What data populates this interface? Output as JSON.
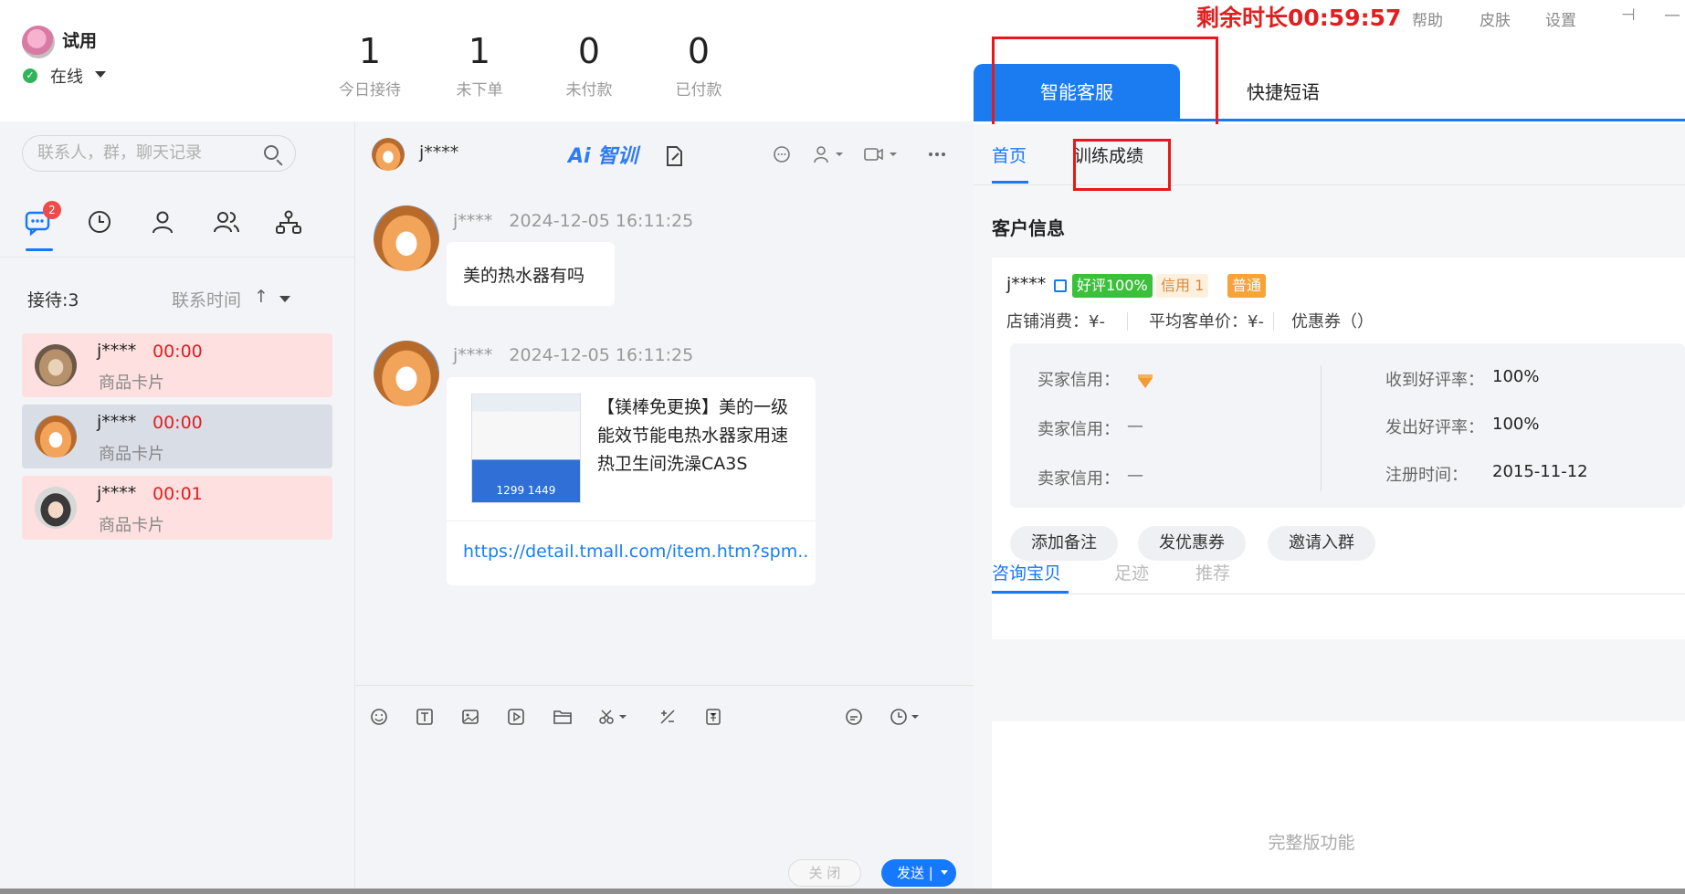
{
  "user": {
    "name": "试用",
    "status": "在线"
  },
  "stats": [
    {
      "value": "1",
      "label": "今日接待"
    },
    {
      "value": "1",
      "label": "未下单"
    },
    {
      "value": "0",
      "label": "未付款"
    },
    {
      "value": "0",
      "label": "已付款"
    }
  ],
  "topbar": {
    "timer": "剩余时长00:59:57",
    "help": "帮助",
    "skin": "皮肤",
    "settings": "设置"
  },
  "left": {
    "search_placeholder": "联系人，群，聊天记录",
    "nav_badge": "2",
    "receiving": "接待:3",
    "sort_label": "联系时间",
    "sort_arrow": "↑",
    "conversations": [
      {
        "name": "j****",
        "time": "00:00",
        "sub": "商品卡片"
      },
      {
        "name": "j****",
        "time": "00:00",
        "sub": "商品卡片"
      },
      {
        "name": "j****",
        "time": "00:01",
        "sub": "商品卡片"
      }
    ]
  },
  "chat": {
    "contact": "j****",
    "ai_logo": "Ai 智训",
    "messages": [
      {
        "sender": "j****",
        "time": "2024-12-05 16:11:25",
        "text": "美的热水器有吗"
      },
      {
        "sender": "j****",
        "time": "2024-12-05 16:11:25",
        "card_title": "【镁棒免更换】美的一级能效节能电热水器家用速热卫生间洗澡CA3S",
        "card_thumb_text": "1299   1449",
        "card_link": "https://detail.tmall.com/item.htm?spm..."
      }
    ],
    "close_label": "关 闭",
    "send_label": "发送 |"
  },
  "right": {
    "tabs": [
      "智能客服",
      "快捷短语"
    ],
    "subtabs": [
      "首页",
      "训练成绩"
    ],
    "section_title": "客户信息",
    "customer": {
      "name": "j****",
      "tag_rating": "好评100%",
      "tag_credit": "信用 1",
      "tag_level": "普通",
      "store_spend": "店铺消费：¥-",
      "avg_price": "平均客单价：¥-",
      "coupon": "优惠券（）"
    },
    "credit": {
      "buyer_label": "买家信用：",
      "seller_label_1": "卖家信用：",
      "seller_value_1": "—",
      "seller_label_2": "卖家信用：",
      "seller_value_2": "—",
      "good_recv_label": "收到好评率：",
      "good_recv_value": "100%",
      "good_sent_label": "发出好评率：",
      "good_sent_value": "100%",
      "reg_label": "注册时间：",
      "reg_value": "2015-11-12"
    },
    "actions": [
      "添加备注",
      "发优惠券",
      "邀请入群"
    ],
    "bottom_tabs": [
      "咨询宝贝",
      "足迹",
      "推荐"
    ],
    "full_version": "完整版功能"
  },
  "colors": {
    "accent": "#1677ff",
    "alert": "#e02020",
    "pink_row": "#fde0df",
    "selected_row": "#d9dde6"
  }
}
